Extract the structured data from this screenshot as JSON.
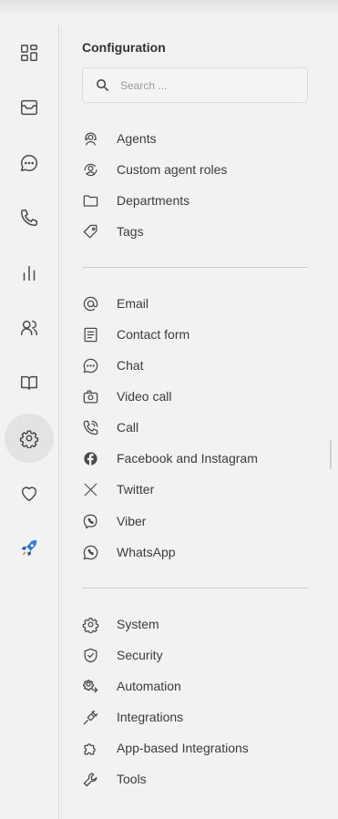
{
  "rail": {
    "items": [
      {
        "icon": "dashboard-icon"
      },
      {
        "icon": "mail-icon"
      },
      {
        "icon": "chat-bubble-icon"
      },
      {
        "icon": "phone-icon"
      },
      {
        "icon": "bar-chart-icon"
      },
      {
        "icon": "users-icon"
      },
      {
        "icon": "book-icon"
      },
      {
        "icon": "gear-icon",
        "active": true
      },
      {
        "icon": "heart-icon"
      },
      {
        "icon": "rocket-icon"
      }
    ]
  },
  "config": {
    "title": "Configuration",
    "search_placeholder": "Search ...",
    "group1": [
      {
        "label": "Agents",
        "icon": "agent-headset-icon"
      },
      {
        "label": "Custom agent roles",
        "icon": "agent-roles-icon"
      },
      {
        "label": "Departments",
        "icon": "folder-icon"
      },
      {
        "label": "Tags",
        "icon": "tag-icon"
      }
    ],
    "group2": [
      {
        "label": "Email",
        "icon": "at-icon"
      },
      {
        "label": "Contact form",
        "icon": "form-icon"
      },
      {
        "label": "Chat",
        "icon": "chat-icon"
      },
      {
        "label": "Video call",
        "icon": "video-call-icon"
      },
      {
        "label": "Call",
        "icon": "phone-call-icon"
      },
      {
        "label": "Facebook and Instagram",
        "icon": "facebook-icon"
      },
      {
        "label": "Twitter",
        "icon": "x-twitter-icon"
      },
      {
        "label": "Viber",
        "icon": "viber-icon"
      },
      {
        "label": "WhatsApp",
        "icon": "whatsapp-icon"
      }
    ],
    "group3": [
      {
        "label": "System",
        "icon": "system-gear-icon"
      },
      {
        "label": "Security",
        "icon": "shield-check-icon"
      },
      {
        "label": "Automation",
        "icon": "automation-icon"
      },
      {
        "label": "Integrations",
        "icon": "plug-icon"
      },
      {
        "label": "App-based Integrations",
        "icon": "puzzle-icon"
      },
      {
        "label": "Tools",
        "icon": "wrench-icon"
      }
    ]
  },
  "colors": {
    "background": "#f2f2f2",
    "active_rail_bg": "#e3e3e3",
    "rocket_blue": "#2f7fe0",
    "rocket_orange": "#f07a28"
  }
}
